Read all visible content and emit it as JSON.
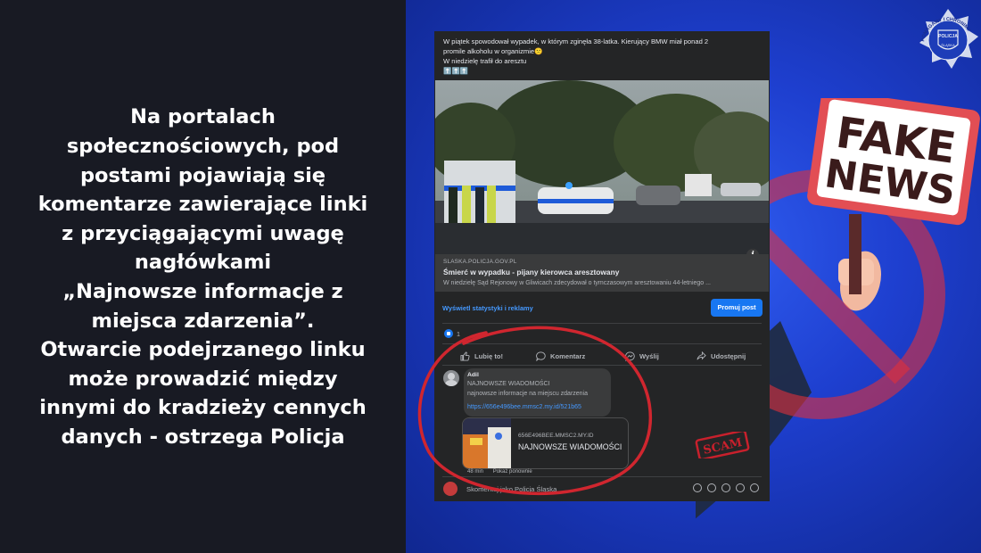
{
  "left_panel": {
    "lines": [
      "Na portalach",
      "społecznościowych, pod",
      "postami pojawiają się",
      "komentarze zawierające linki",
      "z przyciągającymi uwagę",
      "nagłówkami",
      "„Najnowsze informacje z",
      "miejsca zdarzenia”.",
      "Otwarcie podejrzanego linku",
      "może prowadzić między",
      "innymi do kradzieży cennych",
      "danych - ostrzega Policja"
    ]
  },
  "badge": {
    "arc_text": "POMAGAMY I CHRONIMY",
    "shield_line1": "POLICJA",
    "shield_line2": "ŚLĄSKA"
  },
  "sign": {
    "line1": "FAKE",
    "line2": "NEWS"
  },
  "post": {
    "text_lines": [
      "W piątek spowodował wypadek, w którym zginęła 38-latka. Kierujący BMW miał ponad  2",
      "promile alkoholu w organizmie🙁",
      "W niedzielę trafił do aresztu",
      "⬆️⬆️⬆️"
    ],
    "link_domain": "SLASKA.POLICJA.GOV.PL",
    "link_title": "Śmierć w wypadku - pijany kierowca aresztowany",
    "link_desc": "W niedzielę Sąd Rejonowy w Gliwicach zdecydował o tymczasowym aresztowaniu 44-letniego ...",
    "info_label": "i",
    "stats_link": "Wyświetl statystyki i reklamy",
    "promote_button": "Promuj post",
    "like_count": "1",
    "actions": {
      "like": "Lubię to!",
      "comment": "Komentarz",
      "send": "Wyślij",
      "share": "Udostępnij"
    },
    "comment": {
      "author": "Adil",
      "line1": "NAJNOWSZE WIADOMOŚCI",
      "line2": "najnowsze informacje na miejscu zdarzenia",
      "url": "https://656e496bee.mmsc2.my.id/521b65",
      "card_domain": "656E496BEE.MMSC2.MY.ID",
      "card_title": "NAJNOWSZE WIADOMOŚCI",
      "time": "48 min",
      "show_again": "Pokaż ponownie"
    },
    "scam_label": "SCAM",
    "composer_placeholder": "Skomentuj jako Policja Śląska"
  },
  "colors": {
    "left_bg": "#181a23",
    "right_bg": "#2448e0",
    "fb_dark": "#242526",
    "fb_blue": "#1877f2",
    "scam_red": "#c8202c"
  }
}
